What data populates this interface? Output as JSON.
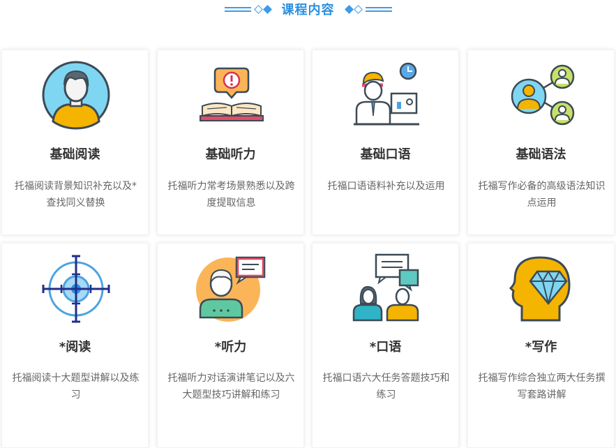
{
  "header": {
    "title": "课程内容"
  },
  "cards": [
    {
      "title": "基础阅读",
      "desc": "托福阅读背景知识补充以及*查找同义替换",
      "icon": "student-avatar-icon"
    },
    {
      "title": "基础听力",
      "desc": "托福听力常考场景熟悉以及跨度提取信息",
      "icon": "book-alert-icon"
    },
    {
      "title": "基础口语",
      "desc": "托福口语语料补充以及运用",
      "icon": "speaker-at-desk-icon"
    },
    {
      "title": "基础语法",
      "desc": "托福写作必备的高级语法知识点运用",
      "icon": "people-network-icon"
    },
    {
      "title": "*阅读",
      "desc": "托福阅读十大题型讲解以及练习",
      "icon": "target-crosshair-icon"
    },
    {
      "title": "*听力",
      "desc": "托福听力对话演讲笔记以及六大题型技巧讲解和练习",
      "icon": "person-speech-bubble-icon"
    },
    {
      "title": "*口语",
      "desc": "托福口语六大任务答题技巧和练习",
      "icon": "conversation-icon"
    },
    {
      "title": "*写作",
      "desc": "托福写作综合独立两大任务撰写套路讲解",
      "icon": "diamond-head-icon"
    }
  ],
  "colors": {
    "accent": "#2b8fe0",
    "title_text": "#333333",
    "desc_text": "#666666"
  }
}
